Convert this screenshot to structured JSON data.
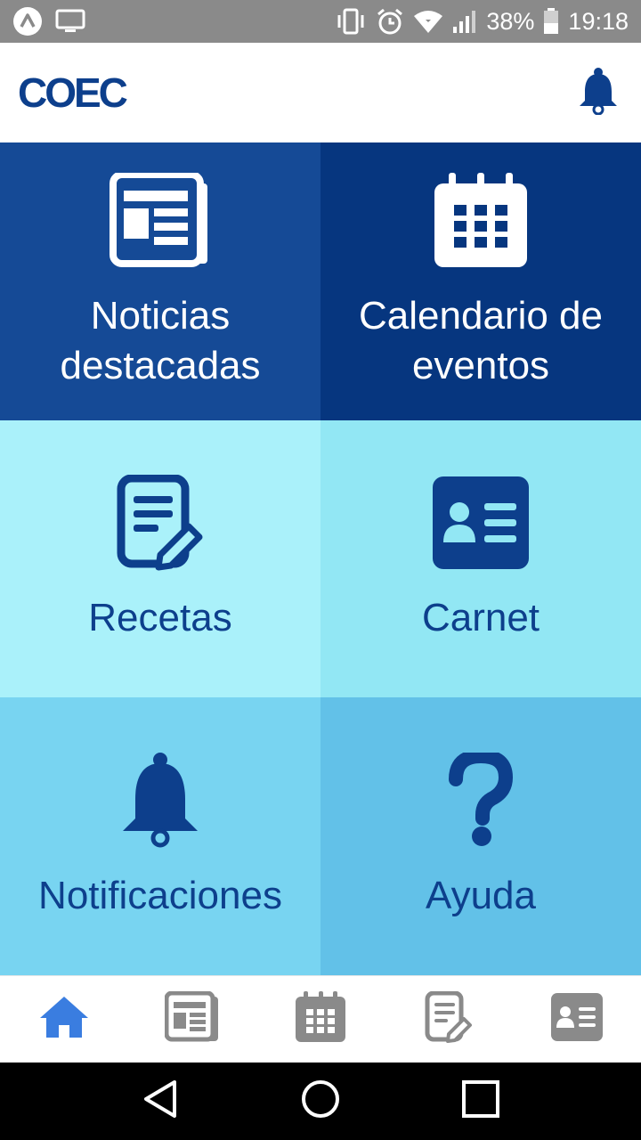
{
  "status_bar": {
    "battery": "38%",
    "time": "19:18",
    "icons": [
      "app-indicator-icon",
      "screen-cast-icon",
      "vibrate-icon",
      "alarm-icon",
      "wifi-icon",
      "signal-icon",
      "battery-icon"
    ]
  },
  "header": {
    "logo": "COEC",
    "bell_icon": "bell-icon"
  },
  "tiles": [
    {
      "label_line1": "Noticias",
      "label_line2": "destacadas",
      "icon": "newspaper-icon"
    },
    {
      "label_line1": "Calendario de",
      "label_line2": "eventos",
      "icon": "calendar-icon"
    },
    {
      "label": "Recetas",
      "icon": "prescription-icon"
    },
    {
      "label": "Carnet",
      "icon": "id-card-icon"
    },
    {
      "label": "Notificaciones",
      "icon": "bell-icon"
    },
    {
      "label": "Ayuda",
      "icon": "question-icon"
    }
  ],
  "bottom_nav": {
    "items": [
      "home-icon",
      "newspaper-icon",
      "calendar-icon",
      "prescription-icon",
      "id-card-icon"
    ],
    "active": "home-icon"
  },
  "colors": {
    "brand": "#0d3f8c",
    "active_nav": "#3a7de0",
    "inactive_nav": "#8a8a8a"
  }
}
